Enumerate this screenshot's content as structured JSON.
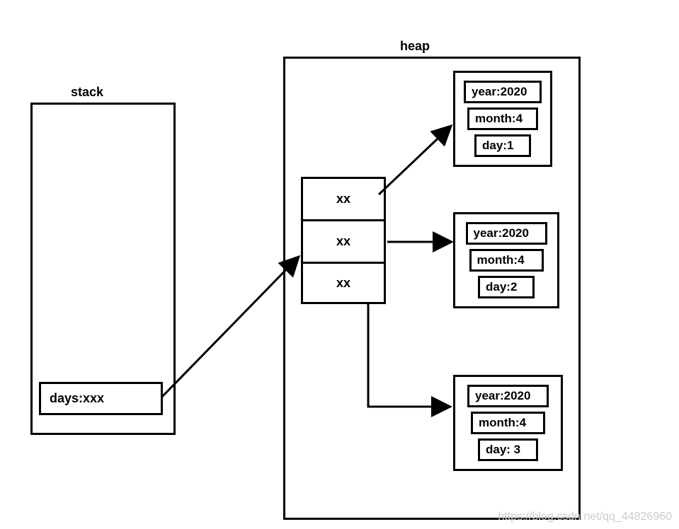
{
  "labels": {
    "stack": "stack",
    "heap": "heap"
  },
  "stack": {
    "item": "days:xxx"
  },
  "array": {
    "cell0": "xx",
    "cell1": "xx",
    "cell2": "xx"
  },
  "objects": [
    {
      "year": "year:2020",
      "month": "month:4",
      "day": "day:1"
    },
    {
      "year": "year:2020",
      "month": "month:4",
      "day": "day:2"
    },
    {
      "year": "year:2020",
      "month": "month:4",
      "day": "day: 3"
    }
  ],
  "watermark": "https://blog.csdn.net/qq_44826960"
}
